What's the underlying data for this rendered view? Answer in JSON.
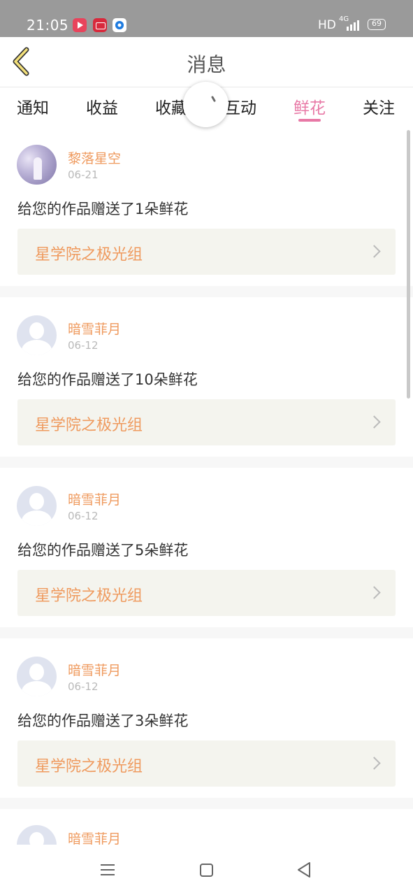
{
  "status_bar": {
    "time": "21:05",
    "network_type": "HD",
    "network_label": "4G",
    "battery": "69",
    "notification_icons": [
      "video-app-icon",
      "record-app-icon",
      "browser-app-icon"
    ]
  },
  "header": {
    "title": "消息",
    "back_icon": "chevron-left-icon"
  },
  "tabs": [
    {
      "label": "通知",
      "active": false
    },
    {
      "label": "收益",
      "active": false
    },
    {
      "label": "收藏",
      "active": false
    },
    {
      "label": "互动",
      "active": false
    },
    {
      "label": "鲜花",
      "active": true
    },
    {
      "label": "关注",
      "active": false
    }
  ],
  "loading": true,
  "messages": [
    {
      "sender": "黎落星空",
      "date": "06-21",
      "text": "给您的作品赠送了1朵鲜花",
      "work": "星学院之极光组",
      "avatar": "photo"
    },
    {
      "sender": "暗雪菲月",
      "date": "06-12",
      "text": "给您的作品赠送了10朵鲜花",
      "work": "星学院之极光组",
      "avatar": "default"
    },
    {
      "sender": "暗雪菲月",
      "date": "06-12",
      "text": "给您的作品赠送了5朵鲜花",
      "work": "星学院之极光组",
      "avatar": "default"
    },
    {
      "sender": "暗雪菲月",
      "date": "06-12",
      "text": "给您的作品赠送了3朵鲜花",
      "work": "星学院之极光组",
      "avatar": "default"
    },
    {
      "sender": "暗雪菲月",
      "date": "",
      "text": "",
      "work": "",
      "avatar": "default"
    }
  ],
  "nav_bar": {
    "icons": [
      "menu-icon",
      "home-icon",
      "back-icon"
    ]
  },
  "colors": {
    "accent_pink": "#e879a6",
    "name_orange": "#ef9a5e",
    "link_bg": "#f4f4ee",
    "status_bar_bg": "#9a9a9a"
  }
}
